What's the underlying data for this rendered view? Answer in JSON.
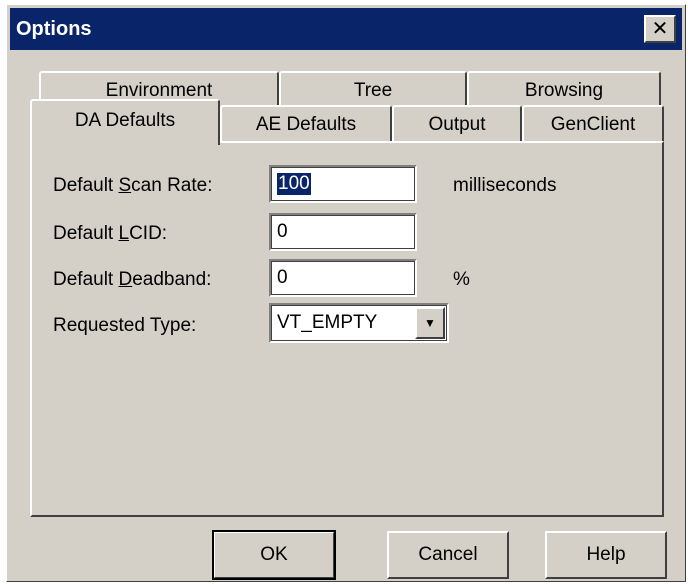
{
  "window": {
    "title": "Options",
    "close_glyph": "✕"
  },
  "tabs": {
    "row_back": [
      {
        "label": "Environment"
      },
      {
        "label": "Tree"
      },
      {
        "label": "Browsing"
      }
    ],
    "row_front": [
      {
        "label": "DA Defaults",
        "selected": true
      },
      {
        "label": "AE Defaults"
      },
      {
        "label": "Output"
      },
      {
        "label": "GenClient"
      }
    ]
  },
  "form": {
    "scan_rate": {
      "label_pre": "Default ",
      "label_key": "S",
      "label_post": "can Rate:",
      "value": "100",
      "unit": "milliseconds"
    },
    "lcid": {
      "label_pre": "Default ",
      "label_key": "L",
      "label_post": "CID:",
      "value": "0"
    },
    "deadband": {
      "label_pre": "Default ",
      "label_key": "D",
      "label_post": "eadband:",
      "value": "0",
      "unit": "%"
    },
    "requested_type": {
      "label": "Requested Type:",
      "value": "VT_EMPTY"
    }
  },
  "buttons": {
    "ok": "OK",
    "cancel": "Cancel",
    "help": "Help"
  },
  "colors": {
    "titlebar": "#0a246a",
    "face": "#d4d0c8"
  }
}
